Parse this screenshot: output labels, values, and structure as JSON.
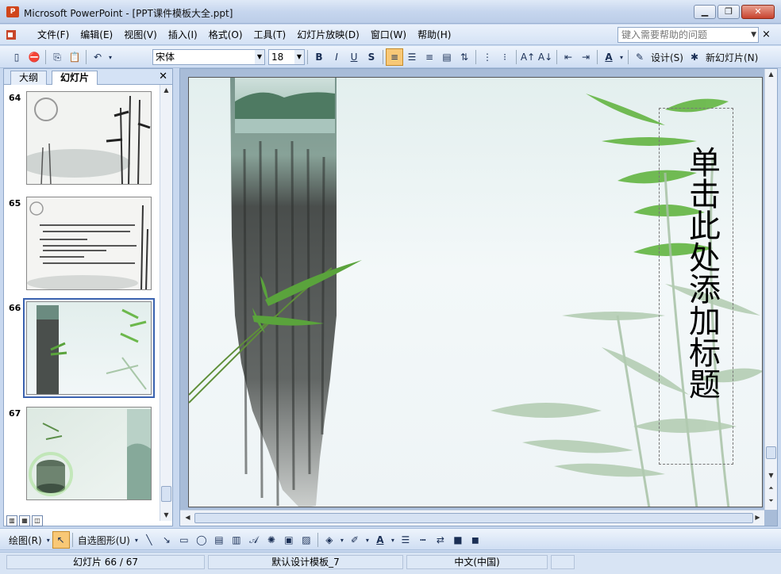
{
  "window": {
    "title": "Microsoft PowerPoint - [PPT课件模板大全.ppt]",
    "app_icon": "powerpoint-icon",
    "buttons": [
      "minimize-icon",
      "restore-icon",
      "close-icon"
    ]
  },
  "menu": {
    "items": [
      "文件(F)",
      "编辑(E)",
      "视图(V)",
      "插入(I)",
      "格式(O)",
      "工具(T)",
      "幻灯片放映(D)",
      "窗口(W)",
      "帮助(H)"
    ],
    "help_placeholder": "键入需要帮助的问题",
    "close": "×"
  },
  "toolbar": {
    "font_name": "宋体",
    "font_size": "18",
    "bold": "B",
    "italic": "I",
    "underline": "U",
    "shadow": "S",
    "design_label": "设计(S)",
    "new_slide_label": "新幻灯片(N)"
  },
  "left_panel": {
    "tabs": [
      "大纲",
      "幻灯片"
    ],
    "slides": [
      {
        "number": "64",
        "selected": false
      },
      {
        "number": "65",
        "selected": false
      },
      {
        "number": "66",
        "selected": true
      },
      {
        "number": "67",
        "selected": false
      }
    ]
  },
  "slide": {
    "title_placeholder": "单击此处添加标题"
  },
  "draw_toolbar": {
    "draw_label": "绘图(R)",
    "autoshapes_label": "自选图形(U)"
  },
  "status": {
    "slide_position": "幻灯片 66 / 67",
    "design_template": "默认设计模板_7",
    "language": "中文(中国)"
  },
  "colors": {
    "accent": "#3a62b0",
    "bamboo_green": "#5aa33c",
    "active_button": "#f8c876"
  }
}
